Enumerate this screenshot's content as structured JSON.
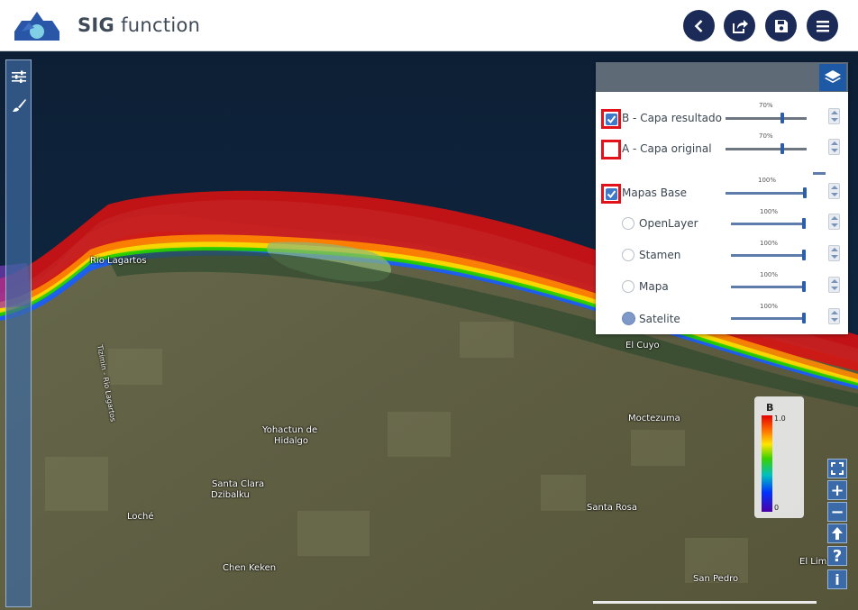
{
  "app": {
    "brand_bold": "SIG",
    "brand_rest": "function"
  },
  "header": {
    "buttons": [
      {
        "name": "back",
        "icon": "chevron-left-icon"
      },
      {
        "name": "share",
        "icon": "share-icon"
      },
      {
        "name": "save",
        "icon": "save-icon"
      },
      {
        "name": "menu",
        "icon": "hamburger-icon"
      }
    ]
  },
  "map": {
    "places": {
      "rio_lagartos": "Rio Lagartos",
      "tizimin": "Tizimin - Rio Lagartos",
      "yohactun_1": "Yohactun de",
      "yohactun_2": "Hidalgo",
      "santa_clara_1": "Santa Clara",
      "santa_clara_2": "Dzibalku",
      "loche": "Loché",
      "chen_keken": "Chen Keken",
      "moctezuma": "Moctezuma",
      "santa_rosa": "Santa Rosa",
      "san_pedro": "San Pedro",
      "el_cuyo": "El Cuyo",
      "el_limon": "El Limón"
    }
  },
  "layers": {
    "b": {
      "label": "B - Capa resultado",
      "opacity_text": "70%",
      "opacity": 0.7,
      "checked": true
    },
    "a": {
      "label": "A - Capa original",
      "opacity_text": "70%",
      "opacity": 0.7,
      "checked": false
    },
    "base": {
      "label": "Mapas Base",
      "opacity_text": "100%",
      "opacity": 1.0,
      "checked": true
    },
    "basemaps": [
      {
        "label": "OpenLayer",
        "opacity_text": "100%",
        "selected": false
      },
      {
        "label": "Stamen",
        "opacity_text": "100%",
        "selected": false
      },
      {
        "label": "Mapa",
        "opacity_text": "100%",
        "selected": false
      },
      {
        "label": "Satelite",
        "opacity_text": "100%",
        "selected": true
      }
    ]
  },
  "legend": {
    "title": "B",
    "max": "1.0",
    "min": "0"
  },
  "zoom": {
    "plus": "+",
    "minus": "−",
    "help": "?",
    "info": "i"
  },
  "colors": {
    "header_button": "#1b2a57",
    "panel_blue": "#3a6aa8",
    "highlight": "#e2111a"
  }
}
